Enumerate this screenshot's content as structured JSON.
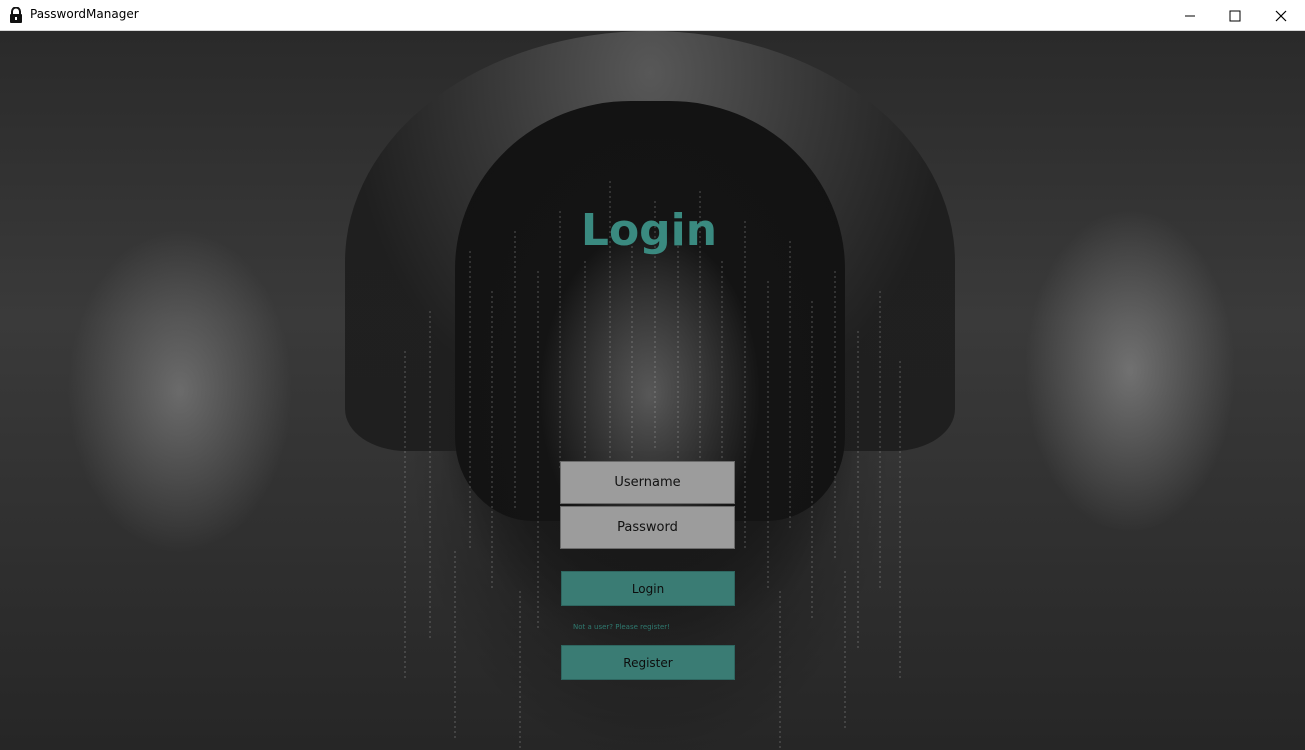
{
  "window": {
    "title": "PasswordManager",
    "app_icon": "padlock-icon",
    "controls": {
      "minimize": "minimize-icon",
      "maximize": "maximize-icon",
      "close": "close-icon"
    }
  },
  "form": {
    "heading": "Login",
    "username_placeholder": "Username",
    "password_placeholder": "Password",
    "login_label": "Login",
    "register_hint": "Not a user? Please register!",
    "register_label": "Register"
  },
  "colors": {
    "accent": "#3a8a80",
    "button": "#3a7c74",
    "field": "#9c9c9c"
  }
}
